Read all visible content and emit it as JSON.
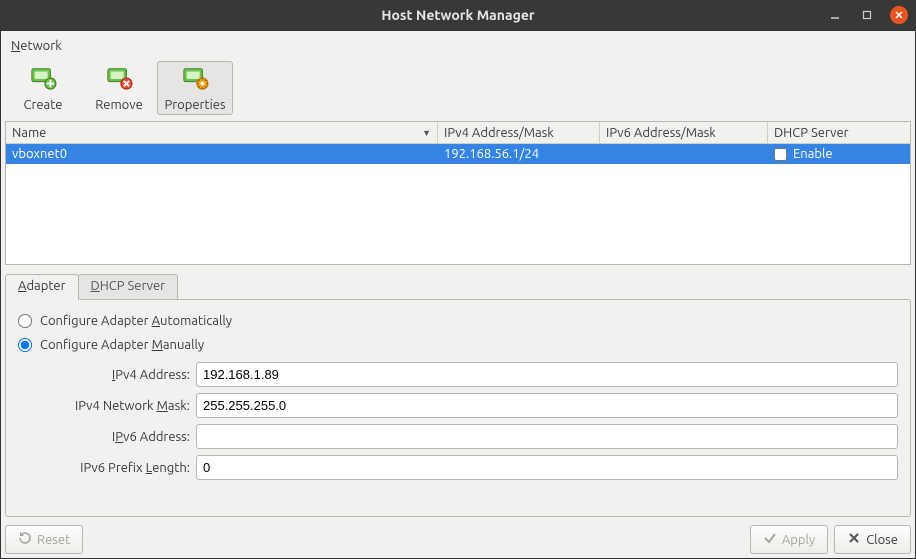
{
  "window": {
    "title": "Host Network Manager"
  },
  "menubar": {
    "network": "Network"
  },
  "toolbar": {
    "create": "Create",
    "remove": "Remove",
    "properties": "Properties"
  },
  "table": {
    "headers": {
      "name": "Name",
      "ipv4": "IPv4 Address/Mask",
      "ipv6": "IPv6 Address/Mask",
      "dhcp": "DHCP Server"
    },
    "rows": [
      {
        "name": "vboxnet0",
        "ipv4": "192.168.56.1/24",
        "ipv6": "",
        "dhcp_label": "Enable",
        "dhcp_checked": false,
        "selected": true
      }
    ]
  },
  "tabs": {
    "adapter": "Adapter",
    "dhcp_server": "DHCP Server"
  },
  "adapter_panel": {
    "auto": "Configure Adapter Automatically",
    "manual": "Configure Adapter Manually",
    "ipv4_address_label": "IPv4 Address:",
    "ipv4_address_value": "192.168.1.89",
    "ipv4_mask_label": "IPv4 Network Mask:",
    "ipv4_mask_value": "255.255.255.0",
    "ipv6_address_label": "IPv6 Address:",
    "ipv6_address_value": "",
    "ipv6_prefix_label": "IPv6 Prefix Length:",
    "ipv6_prefix_value": "0"
  },
  "buttons": {
    "reset": "Reset",
    "apply": "Apply",
    "close": "Close"
  }
}
